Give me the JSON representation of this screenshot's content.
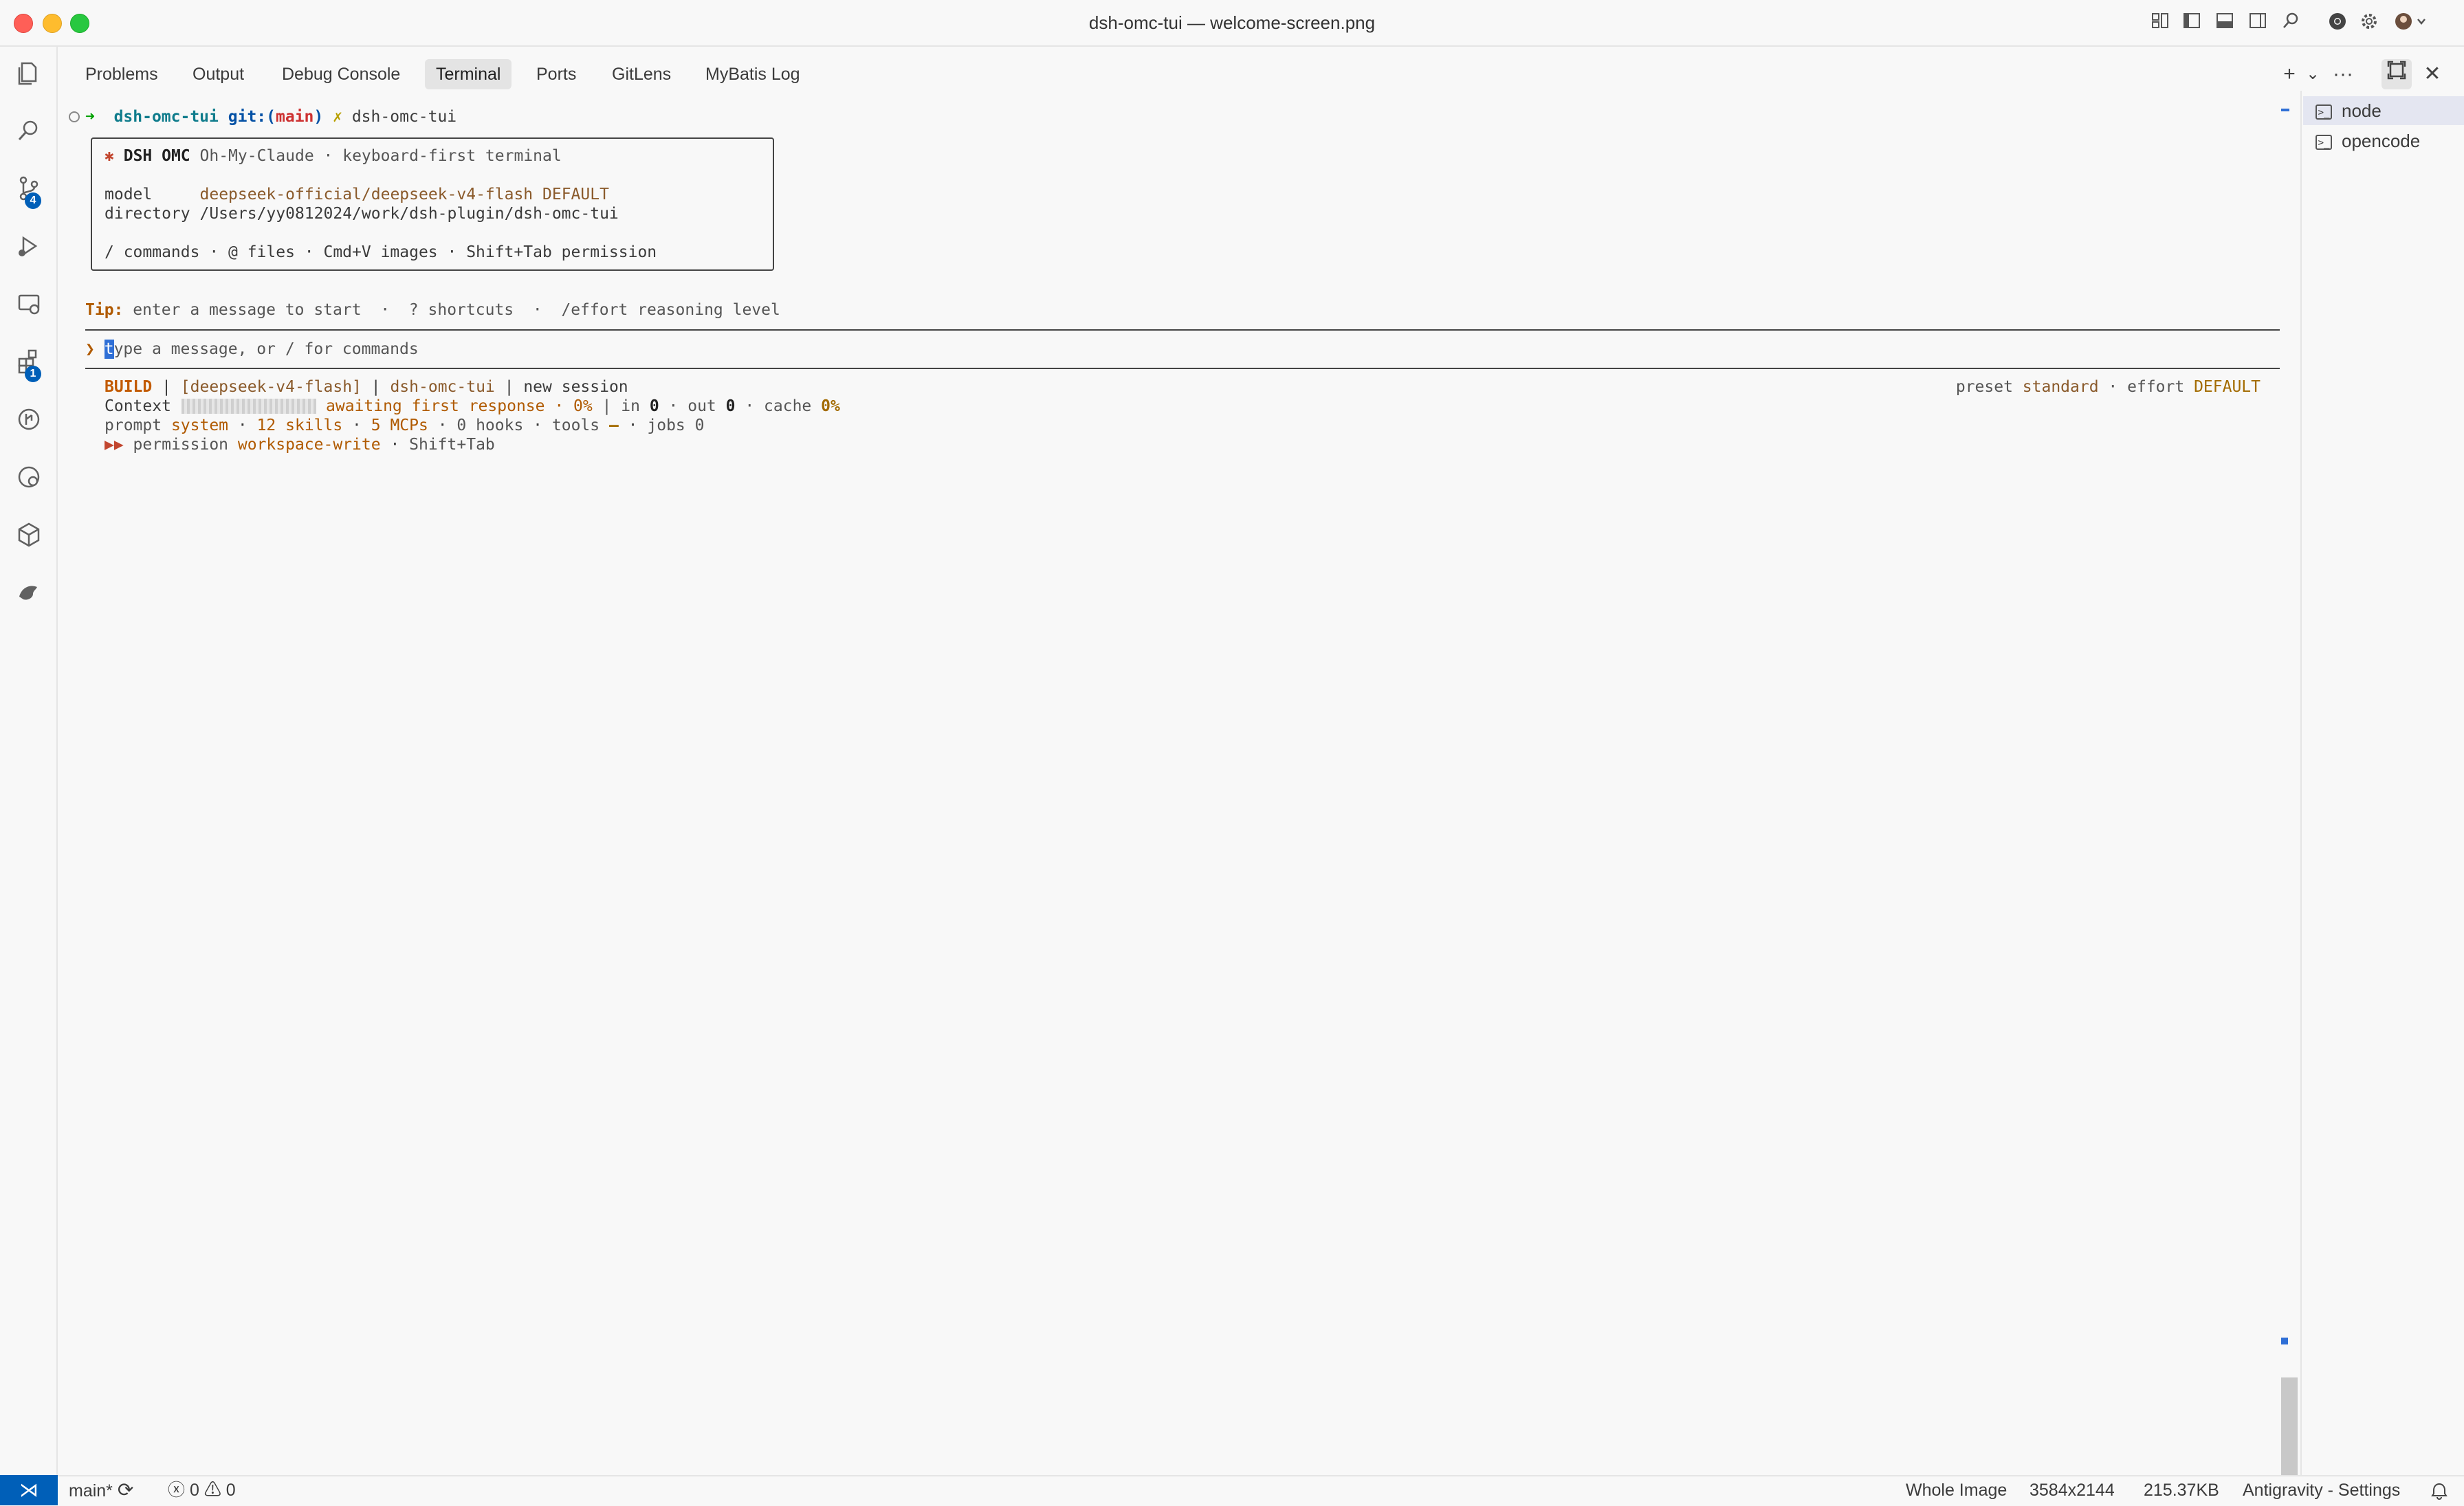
{
  "window": {
    "title": "dsh-omc-tui — welcome-screen.png"
  },
  "titlebar_icons": [
    "layout-icon",
    "sidebar-left-icon",
    "panel-icon",
    "sidebar-right-icon",
    "search-icon",
    "chrome-icon",
    "gear-icon",
    "account-icon"
  ],
  "activity": [
    {
      "name": "explorer-icon",
      "glyph": "❐"
    },
    {
      "name": "search-icon",
      "glyph": "⌕"
    },
    {
      "name": "source-control-icon",
      "glyph": "⑂",
      "badge": "4"
    },
    {
      "name": "run-debug-icon",
      "glyph": "▷"
    },
    {
      "name": "remote-explorer-icon",
      "glyph": "▭"
    },
    {
      "name": "extensions-icon",
      "glyph": "⊞",
      "badge": "1"
    },
    {
      "name": "gitlens-icon",
      "glyph": "◔"
    },
    {
      "name": "testing-icon",
      "glyph": "⚗"
    },
    {
      "name": "containers-icon",
      "glyph": "⬡"
    },
    {
      "name": "mybatis-icon",
      "glyph": "🐦"
    }
  ],
  "panel": {
    "tabs": [
      "Problems",
      "Output",
      "Debug Console",
      "Terminal",
      "Ports",
      "GitLens",
      "MyBatis Log"
    ],
    "active_tab": "Terminal",
    "actions": {
      "add": "+",
      "dropdown": "⌄",
      "more": "···",
      "maximize": "⧉",
      "close": "✕"
    }
  },
  "terminal": {
    "prompt": {
      "arrow": "➜",
      "dir": "dsh-omc-tui",
      "git_label": "git:(",
      "branch": "main",
      "git_close": ")",
      "dirty": "✗",
      "command": "dsh-omc-tui"
    },
    "welcome": {
      "star": "✱",
      "brand": "DSH OMC",
      "tagline": "Oh-My-Claude · keyboard-first terminal",
      "model_label": "model",
      "model_value": "deepseek-official/deepseek-v4-flash DEFAULT",
      "directory_label": "directory",
      "directory_value": "/Users/yy0812024/work/dsh-plugin/dsh-omc-tui",
      "hints": "/ commands · @ files · Cmd+V images · Shift+Tab permission"
    },
    "tip": {
      "label": "Tip:",
      "text": " enter a message to start  ·  ? shortcuts  ·  /effort reasoning level"
    },
    "input": {
      "caret": "❯",
      "first": "t",
      "placeholder_rest": "ype a message, or / for commands"
    },
    "status": {
      "mode": "BUILD",
      "sep": " | ",
      "model": "[deepseek-v4-flash]",
      "project": "dsh-omc-tui",
      "session": "new session",
      "preset_label": "preset ",
      "preset_value": "standard",
      "effort_label": " · effort ",
      "effort_value": "DEFAULT",
      "context_label": "Context",
      "context_percent": 0,
      "context_status": "awaiting first response · 0%",
      "in_label": " | in ",
      "in_value": "0",
      "out_label": " · out ",
      "out_value": "0",
      "cache_label": " · cache ",
      "cache_value": "0%",
      "prompt_label": "prompt ",
      "prompt_value": "system",
      "skills": "12 skills",
      "mcps": "5 MCPs",
      "hooks": "0 hooks",
      "tools_label": "tools ",
      "tools_value": "—",
      "jobs": "jobs 0",
      "perm_arrows": "▶▶",
      "perm_label": " permission ",
      "perm_value": "workspace-write",
      "perm_key": "Shift+Tab"
    }
  },
  "terminals_list": [
    {
      "label": "node",
      "selected": true
    },
    {
      "label": "opencode",
      "selected": false
    }
  ],
  "statusbar": {
    "remote_glyph": "⋊",
    "branch": "main*",
    "sync_glyph": "⟳",
    "errors": "0",
    "warnings": "0",
    "view_mode": "Whole Image",
    "dimensions": "3584x2144",
    "file_size": "215.37KB",
    "settings": "Antigravity - Settings",
    "bell_glyph": "🔔"
  }
}
